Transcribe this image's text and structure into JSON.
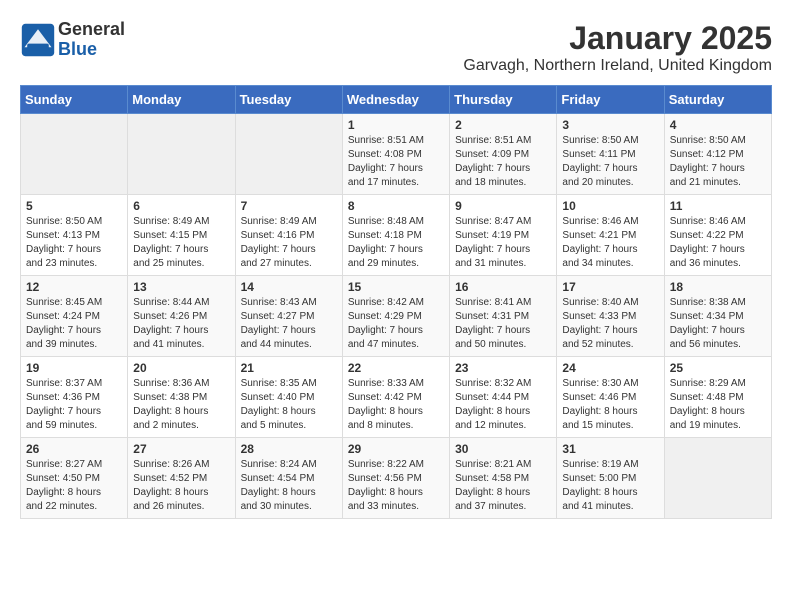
{
  "logo": {
    "general": "General",
    "blue": "Blue"
  },
  "title": "January 2025",
  "location": "Garvagh, Northern Ireland, United Kingdom",
  "days_of_week": [
    "Sunday",
    "Monday",
    "Tuesday",
    "Wednesday",
    "Thursday",
    "Friday",
    "Saturday"
  ],
  "weeks": [
    [
      {
        "day": "",
        "info": ""
      },
      {
        "day": "",
        "info": ""
      },
      {
        "day": "",
        "info": ""
      },
      {
        "day": "1",
        "info": "Sunrise: 8:51 AM\nSunset: 4:08 PM\nDaylight: 7 hours\nand 17 minutes."
      },
      {
        "day": "2",
        "info": "Sunrise: 8:51 AM\nSunset: 4:09 PM\nDaylight: 7 hours\nand 18 minutes."
      },
      {
        "day": "3",
        "info": "Sunrise: 8:50 AM\nSunset: 4:11 PM\nDaylight: 7 hours\nand 20 minutes."
      },
      {
        "day": "4",
        "info": "Sunrise: 8:50 AM\nSunset: 4:12 PM\nDaylight: 7 hours\nand 21 minutes."
      }
    ],
    [
      {
        "day": "5",
        "info": "Sunrise: 8:50 AM\nSunset: 4:13 PM\nDaylight: 7 hours\nand 23 minutes."
      },
      {
        "day": "6",
        "info": "Sunrise: 8:49 AM\nSunset: 4:15 PM\nDaylight: 7 hours\nand 25 minutes."
      },
      {
        "day": "7",
        "info": "Sunrise: 8:49 AM\nSunset: 4:16 PM\nDaylight: 7 hours\nand 27 minutes."
      },
      {
        "day": "8",
        "info": "Sunrise: 8:48 AM\nSunset: 4:18 PM\nDaylight: 7 hours\nand 29 minutes."
      },
      {
        "day": "9",
        "info": "Sunrise: 8:47 AM\nSunset: 4:19 PM\nDaylight: 7 hours\nand 31 minutes."
      },
      {
        "day": "10",
        "info": "Sunrise: 8:46 AM\nSunset: 4:21 PM\nDaylight: 7 hours\nand 34 minutes."
      },
      {
        "day": "11",
        "info": "Sunrise: 8:46 AM\nSunset: 4:22 PM\nDaylight: 7 hours\nand 36 minutes."
      }
    ],
    [
      {
        "day": "12",
        "info": "Sunrise: 8:45 AM\nSunset: 4:24 PM\nDaylight: 7 hours\nand 39 minutes."
      },
      {
        "day": "13",
        "info": "Sunrise: 8:44 AM\nSunset: 4:26 PM\nDaylight: 7 hours\nand 41 minutes."
      },
      {
        "day": "14",
        "info": "Sunrise: 8:43 AM\nSunset: 4:27 PM\nDaylight: 7 hours\nand 44 minutes."
      },
      {
        "day": "15",
        "info": "Sunrise: 8:42 AM\nSunset: 4:29 PM\nDaylight: 7 hours\nand 47 minutes."
      },
      {
        "day": "16",
        "info": "Sunrise: 8:41 AM\nSunset: 4:31 PM\nDaylight: 7 hours\nand 50 minutes."
      },
      {
        "day": "17",
        "info": "Sunrise: 8:40 AM\nSunset: 4:33 PM\nDaylight: 7 hours\nand 52 minutes."
      },
      {
        "day": "18",
        "info": "Sunrise: 8:38 AM\nSunset: 4:34 PM\nDaylight: 7 hours\nand 56 minutes."
      }
    ],
    [
      {
        "day": "19",
        "info": "Sunrise: 8:37 AM\nSunset: 4:36 PM\nDaylight: 7 hours\nand 59 minutes."
      },
      {
        "day": "20",
        "info": "Sunrise: 8:36 AM\nSunset: 4:38 PM\nDaylight: 8 hours\nand 2 minutes."
      },
      {
        "day": "21",
        "info": "Sunrise: 8:35 AM\nSunset: 4:40 PM\nDaylight: 8 hours\nand 5 minutes."
      },
      {
        "day": "22",
        "info": "Sunrise: 8:33 AM\nSunset: 4:42 PM\nDaylight: 8 hours\nand 8 minutes."
      },
      {
        "day": "23",
        "info": "Sunrise: 8:32 AM\nSunset: 4:44 PM\nDaylight: 8 hours\nand 12 minutes."
      },
      {
        "day": "24",
        "info": "Sunrise: 8:30 AM\nSunset: 4:46 PM\nDaylight: 8 hours\nand 15 minutes."
      },
      {
        "day": "25",
        "info": "Sunrise: 8:29 AM\nSunset: 4:48 PM\nDaylight: 8 hours\nand 19 minutes."
      }
    ],
    [
      {
        "day": "26",
        "info": "Sunrise: 8:27 AM\nSunset: 4:50 PM\nDaylight: 8 hours\nand 22 minutes."
      },
      {
        "day": "27",
        "info": "Sunrise: 8:26 AM\nSunset: 4:52 PM\nDaylight: 8 hours\nand 26 minutes."
      },
      {
        "day": "28",
        "info": "Sunrise: 8:24 AM\nSunset: 4:54 PM\nDaylight: 8 hours\nand 30 minutes."
      },
      {
        "day": "29",
        "info": "Sunrise: 8:22 AM\nSunset: 4:56 PM\nDaylight: 8 hours\nand 33 minutes."
      },
      {
        "day": "30",
        "info": "Sunrise: 8:21 AM\nSunset: 4:58 PM\nDaylight: 8 hours\nand 37 minutes."
      },
      {
        "day": "31",
        "info": "Sunrise: 8:19 AM\nSunset: 5:00 PM\nDaylight: 8 hours\nand 41 minutes."
      },
      {
        "day": "",
        "info": ""
      }
    ]
  ]
}
